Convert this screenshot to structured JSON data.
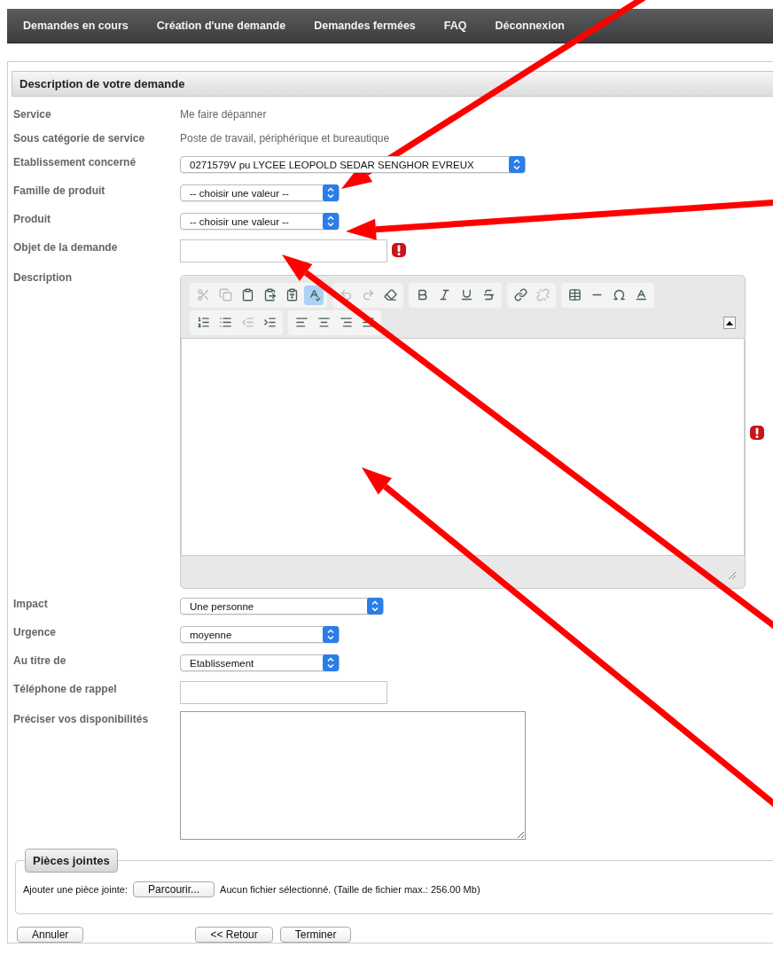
{
  "nav": {
    "items": [
      {
        "label": "Demandes en cours"
      },
      {
        "label": "Création d'une demande"
      },
      {
        "label": "Demandes fermées"
      },
      {
        "label": "FAQ"
      },
      {
        "label": "Déconnexion"
      }
    ]
  },
  "section": {
    "title": "Description de votre demande"
  },
  "fields": [
    {
      "kind": "text",
      "label": "Service",
      "value": "Me faire dépanner",
      "required": false
    },
    {
      "kind": "text",
      "label": "Sous catégorie de service",
      "value": "Poste de travail, périphérique et bureautique",
      "required": false
    },
    {
      "kind": "select",
      "label": "Etablissement concerné",
      "value": "0271579V pu LYCEE LEOPOLD SEDAR SENGHOR EVREUX",
      "required": false
    },
    {
      "kind": "select",
      "label": "Famille de produit",
      "value": "-- choisir une valeur --",
      "required": false
    },
    {
      "kind": "select",
      "label": "Produit",
      "value": "-- choisir une valeur --",
      "required": false
    },
    {
      "kind": "input",
      "label": "Objet de la demande",
      "required": true
    },
    {
      "kind": "editor",
      "label": "Description",
      "required": true
    },
    {
      "kind": "select",
      "label": "Impact",
      "value": "Une personne",
      "required": false
    },
    {
      "kind": "select",
      "label": "Urgence",
      "value": "moyenne",
      "required": false
    },
    {
      "kind": "select",
      "label": "Au titre de",
      "value": "Etablissement",
      "required": false
    },
    {
      "kind": "input",
      "label": "Téléphone de rappel",
      "required": false
    },
    {
      "kind": "textarea",
      "label": "Préciser vos disponibilités",
      "required": false
    }
  ],
  "attachments": {
    "legend": "Pièces jointes",
    "label": "Ajouter une pièce jointe:",
    "button": "Parcourir...",
    "status": "Aucun fichier sélectionné. (Taille de fichier max.: 256.00 Mb)"
  },
  "buttons": [
    {
      "label": "Annuler"
    },
    {
      "label": "<< Retour"
    },
    {
      "label": "Terminer"
    }
  ]
}
